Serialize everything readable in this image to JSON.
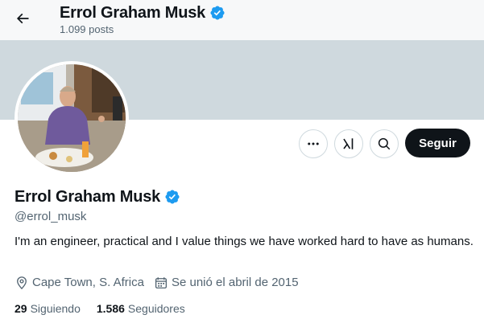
{
  "header": {
    "name": "Errol Graham Musk",
    "posts": "1.099 posts"
  },
  "profile": {
    "name": "Errol Graham Musk",
    "handle": "@errol_musk",
    "bio": "I'm an engineer, practical and I value things we have worked hard to have as humans.",
    "location": "Cape Town, S. Africa",
    "joined": "Se unió el abril de 2015",
    "following_count": "29",
    "following_label": "Siguiendo",
    "followers_count": "1.586",
    "followers_label": "Seguidores"
  },
  "actions": {
    "follow_label": "Seguir"
  },
  "icons": {
    "back": "arrow-left-icon",
    "verified": "verified-badge-icon",
    "more": "more-icon",
    "grok": "grok-icon",
    "search": "search-icon",
    "location": "location-pin-icon",
    "calendar": "calendar-icon"
  },
  "colors": {
    "verified_blue": "#1d9bf0",
    "banner": "#cfd9de",
    "follow_button": "#0f1419",
    "secondary_text": "#536471"
  }
}
